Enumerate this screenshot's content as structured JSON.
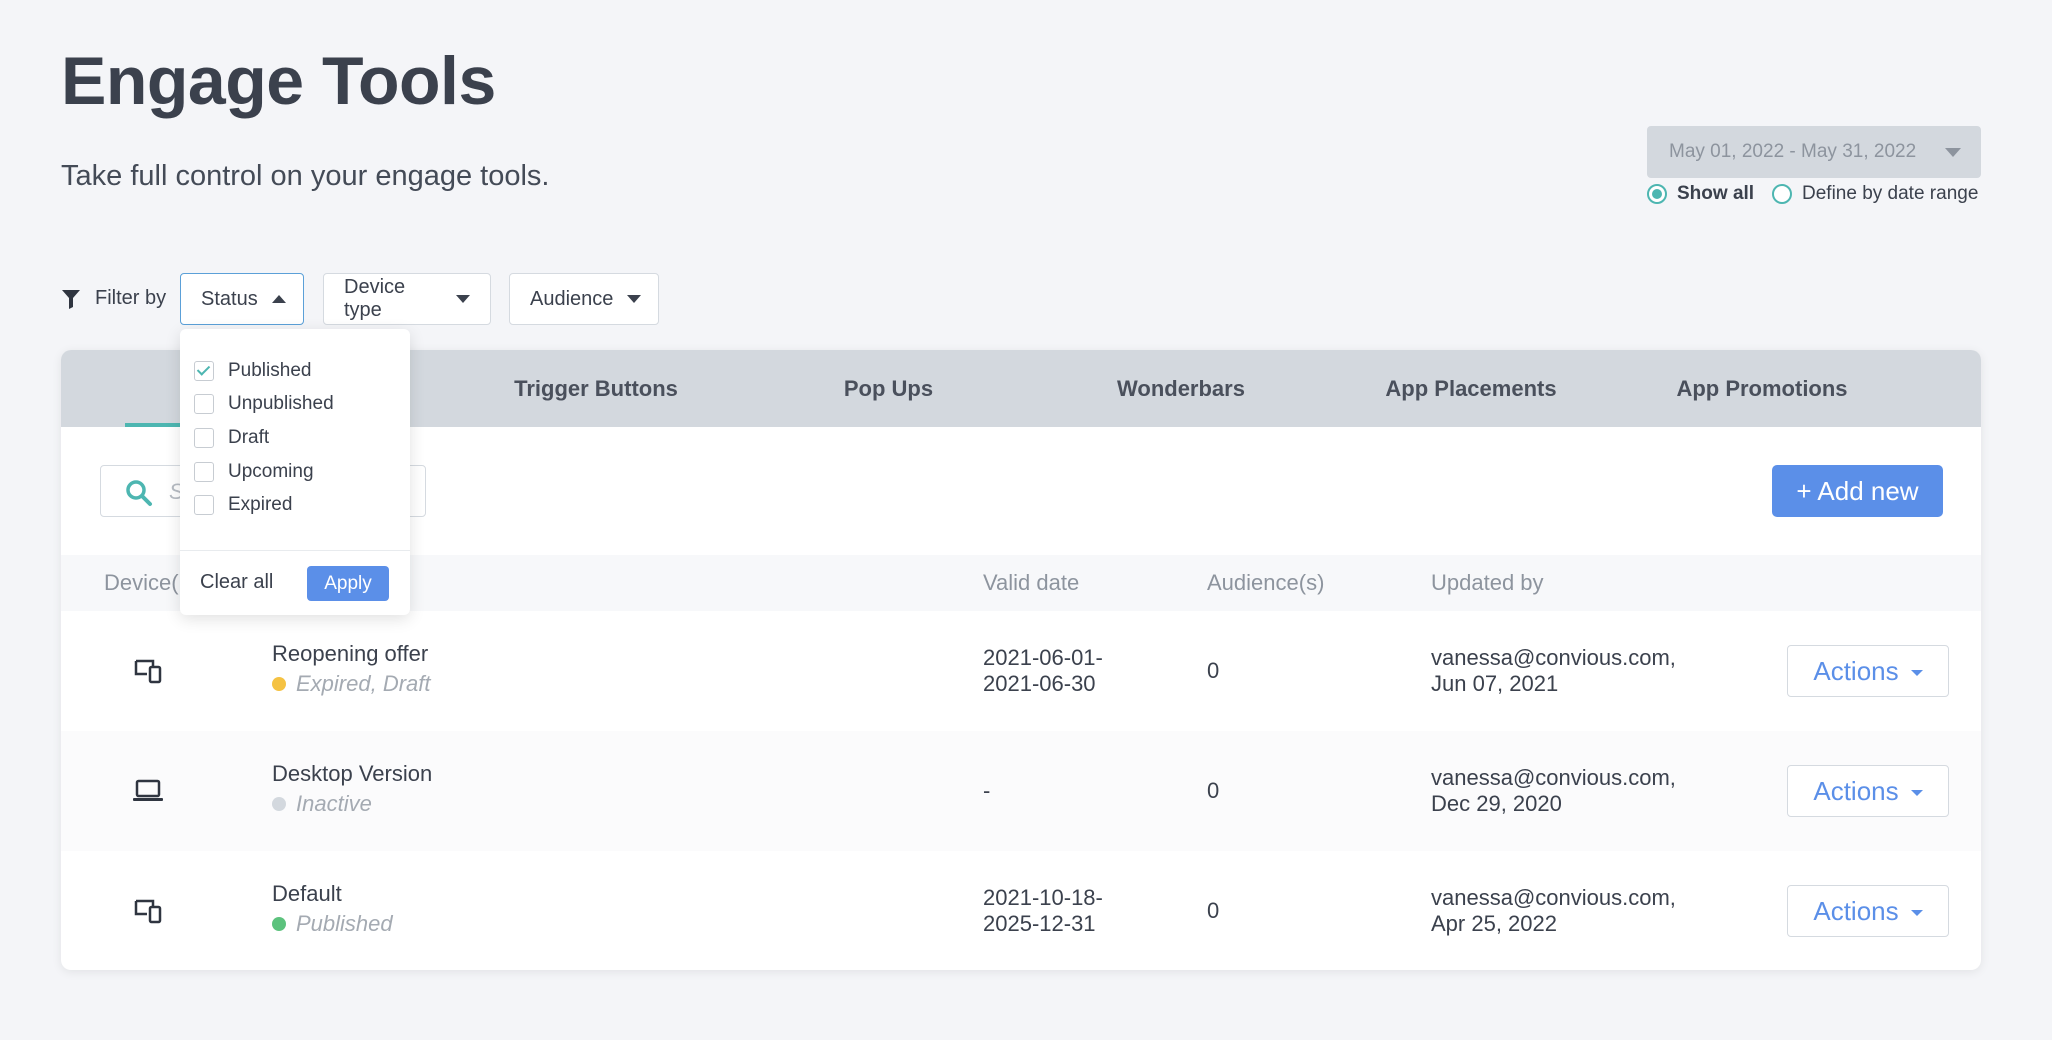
{
  "page": {
    "title": "Engage Tools",
    "subtitle": "Take full control on your engage tools."
  },
  "date_filter": {
    "range_label": "May 01, 2022 - May 31, 2022",
    "options": [
      {
        "label": "Show all",
        "selected": true
      },
      {
        "label": "Define by date range",
        "selected": false
      }
    ]
  },
  "filters": {
    "label": "Filter by",
    "buttons": [
      {
        "label": "Status",
        "open": true
      },
      {
        "label": "Device type",
        "open": false
      },
      {
        "label": "Audience",
        "open": false
      }
    ]
  },
  "status_dropdown": {
    "options": [
      {
        "label": "Published",
        "checked": true
      },
      {
        "label": "Unpublished",
        "checked": false
      },
      {
        "label": "Draft",
        "checked": false
      },
      {
        "label": "Upcoming",
        "checked": false
      },
      {
        "label": "Expired",
        "checked": false
      }
    ],
    "clear_label": "Clear all",
    "apply_label": "Apply"
  },
  "tabs": [
    {
      "label": "Trigger Buttons"
    },
    {
      "label": "Pop Ups"
    },
    {
      "label": "Wonderbars"
    },
    {
      "label": "App Placements"
    },
    {
      "label": "App Promotions"
    }
  ],
  "search": {
    "placeholder": "S"
  },
  "add_button": "+ Add new",
  "table": {
    "headers": {
      "device": "Device(",
      "valid_date": "Valid date",
      "audiences": "Audience(s)",
      "updated_by": "Updated by"
    },
    "rows": [
      {
        "device_icon": "multi-device-icon",
        "name": "Reopening offer",
        "status": "Expired, Draft",
        "status_color": "#f5c242",
        "valid_line1": "2021-06-01-",
        "valid_line2": "2021-06-30",
        "audience": "0",
        "updated_line1": "vanessa@convious.com,",
        "updated_line2": "Jun 07, 2021",
        "actions": "Actions"
      },
      {
        "device_icon": "laptop-icon",
        "name": "Desktop Version",
        "status": "Inactive",
        "status_color": "#d3d8de",
        "valid_line1": "-",
        "valid_line2": "",
        "audience": "0",
        "updated_line1": "vanessa@convious.com,",
        "updated_line2": "Dec 29, 2020",
        "actions": "Actions"
      },
      {
        "device_icon": "multi-device-icon",
        "name": "Default",
        "status": "Published",
        "status_color": "#5cc27d",
        "valid_line1": "2021-10-18-",
        "valid_line2": "2025-12-31",
        "audience": "0",
        "updated_line1": "vanessa@convious.com,",
        "updated_line2": "Apr 25, 2022",
        "actions": "Actions"
      }
    ]
  },
  "colors": {
    "accent": "#4db6b1",
    "primary": "#5b8fe8"
  }
}
